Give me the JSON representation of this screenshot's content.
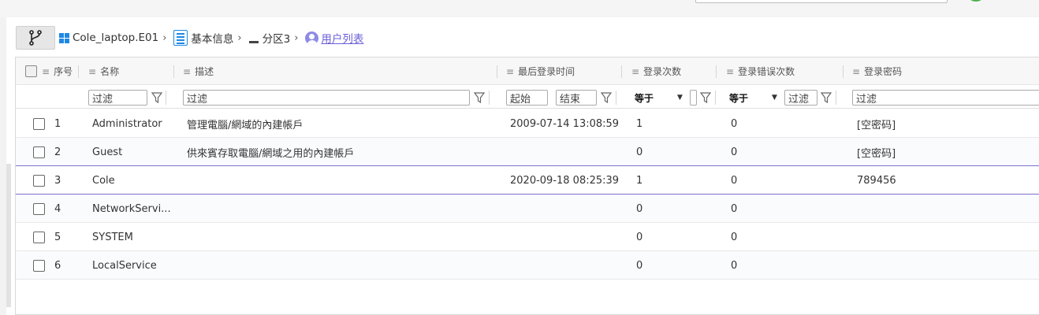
{
  "breadcrumb": {
    "items": [
      {
        "label": "Cole_laptop.E01",
        "icon": "windows-icon"
      },
      {
        "label": "基本信息",
        "icon": "list-icon"
      },
      {
        "label": "分区3",
        "icon": "disk-icon"
      },
      {
        "label": "用户列表",
        "icon": "user-icon"
      }
    ]
  },
  "columns": {
    "index": "序号",
    "name": "名称",
    "desc": "描述",
    "last_login": "最后登录时间",
    "login_count": "登录次数",
    "login_errors": "登录错误次数",
    "password": "登录密码"
  },
  "filters": {
    "name_placeholder": "过滤",
    "desc_placeholder": "过滤",
    "start_placeholder": "起始",
    "end_placeholder": "结束",
    "login_count_op": "等于",
    "login_errors_op": "等于",
    "login_errors_placeholder": "过滤",
    "password_placeholder": "过滤"
  },
  "rows": [
    {
      "index": "1",
      "name": "Administrator",
      "desc": "管理電腦/網域的內建帳戶",
      "last_login": "2009-07-14 13:08:59",
      "login_count": "1",
      "login_errors": "0",
      "password": "[空密码]"
    },
    {
      "index": "2",
      "name": "Guest",
      "desc": "供來賓存取電腦/網域之用的內建帳戶",
      "last_login": "",
      "login_count": "0",
      "login_errors": "0",
      "password": "[空密码]"
    },
    {
      "index": "3",
      "name": "Cole",
      "desc": "",
      "last_login": "2020-09-18 08:25:39",
      "login_count": "1",
      "login_errors": "0",
      "password": "789456"
    },
    {
      "index": "4",
      "name": "NetworkServi...",
      "desc": "",
      "last_login": "",
      "login_count": "0",
      "login_errors": "0",
      "password": ""
    },
    {
      "index": "5",
      "name": "SYSTEM",
      "desc": "",
      "last_login": "",
      "login_count": "0",
      "login_errors": "0",
      "password": ""
    },
    {
      "index": "6",
      "name": "LocalService",
      "desc": "",
      "last_login": "",
      "login_count": "0",
      "login_errors": "0",
      "password": ""
    }
  ],
  "colors": {
    "accent": "#6b5fd8",
    "windows_blue": "#1e88e5"
  }
}
